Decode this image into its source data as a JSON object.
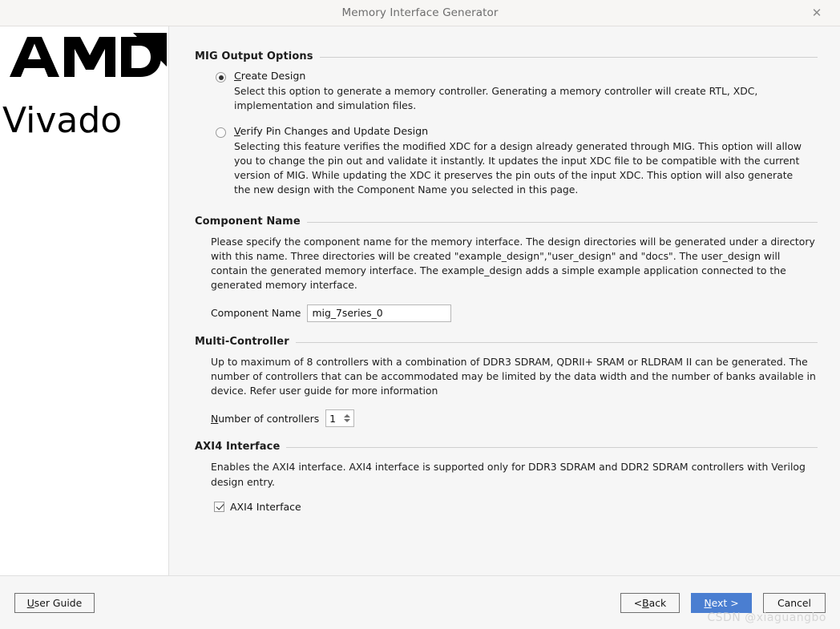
{
  "window": {
    "title": "Memory Interface Generator",
    "close_label": "✕"
  },
  "sidebar": {
    "brand": "AMD",
    "product": "Vivado"
  },
  "sections": {
    "mig_output_options": {
      "title": "MIG Output Options",
      "options": [
        {
          "label_pre": "",
          "label_accel": "C",
          "label_post": "reate Design",
          "label_full": "Create Design",
          "description": "Select this option to generate a memory controller. Generating a memory controller will create RTL, XDC, implementation and simulation files.",
          "selected": true
        },
        {
          "label_pre": "",
          "label_accel": "V",
          "label_post": "erify Pin Changes and Update Design",
          "label_full": "Verify Pin Changes and Update Design",
          "description": "Selecting this feature verifies the modified XDC for a design already generated through MIG. This option will allow you to change the pin out and validate it instantly. It updates the input XDC file to be compatible with the current version of MIG. While updating the XDC it preserves the pin outs of the input XDC. This option will also generate the new design with the Component Name you selected in this page.",
          "selected": false
        }
      ]
    },
    "component_name": {
      "title": "Component Name",
      "description": "Please specify the component name for the memory interface. The design directories will be generated under a directory with this name. Three directories will be created \"example_design\",\"user_design\" and \"docs\". The user_design will contain the generated memory interface. The example_design adds a simple example application connected to the generated memory interface.",
      "field_label": "Component Name",
      "field_value": "mig_7series_0"
    },
    "multi_controller": {
      "title": "Multi-Controller",
      "description": "Up to maximum of 8 controllers with a combination of DDR3 SDRAM, QDRII+ SRAM or RLDRAM II can be generated. The number of controllers that can be accommodated may be limited by the data width and the number of banks available in device. Refer user guide for more information",
      "field_label_accel": "N",
      "field_label_post": "umber of controllers",
      "field_label_full": "Number of controllers",
      "field_value": "1"
    },
    "axi4_interface": {
      "title": "AXI4 Interface",
      "description": "Enables the AXI4 interface. AXI4 interface is supported only for DDR3 SDRAM and DDR2 SDRAM controllers with Verilog design entry.",
      "checkbox_label": "AXI4 Interface",
      "checked": true
    }
  },
  "footer": {
    "user_guide": {
      "accel": "U",
      "post": "ser Guide",
      "full": "User Guide"
    },
    "back": {
      "pre": "< ",
      "accel": "B",
      "post": "ack",
      "full": "< Back"
    },
    "next": {
      "accel": "N",
      "post": "ext  >",
      "full": "Next >"
    },
    "cancel": {
      "full": "Cancel"
    },
    "watermark": "CSDN @xiaguangbo"
  },
  "colors": {
    "accent": "#4a7ed1",
    "title_text": "#6d6d6d",
    "panel_bg": "#f6f6f6",
    "sidebar_bg": "#ffffff"
  }
}
